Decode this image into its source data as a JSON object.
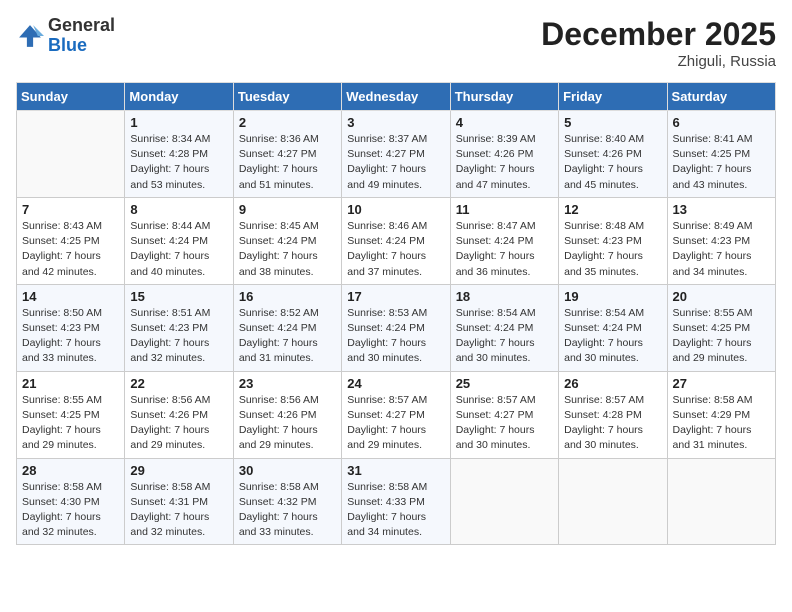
{
  "header": {
    "logo_general": "General",
    "logo_blue": "Blue",
    "title": "December 2025",
    "location": "Zhiguli, Russia"
  },
  "weekdays": [
    "Sunday",
    "Monday",
    "Tuesday",
    "Wednesday",
    "Thursday",
    "Friday",
    "Saturday"
  ],
  "weeks": [
    [
      {
        "day": "",
        "info": ""
      },
      {
        "day": "1",
        "info": "Sunrise: 8:34 AM\nSunset: 4:28 PM\nDaylight: 7 hours\nand 53 minutes."
      },
      {
        "day": "2",
        "info": "Sunrise: 8:36 AM\nSunset: 4:27 PM\nDaylight: 7 hours\nand 51 minutes."
      },
      {
        "day": "3",
        "info": "Sunrise: 8:37 AM\nSunset: 4:27 PM\nDaylight: 7 hours\nand 49 minutes."
      },
      {
        "day": "4",
        "info": "Sunrise: 8:39 AM\nSunset: 4:26 PM\nDaylight: 7 hours\nand 47 minutes."
      },
      {
        "day": "5",
        "info": "Sunrise: 8:40 AM\nSunset: 4:26 PM\nDaylight: 7 hours\nand 45 minutes."
      },
      {
        "day": "6",
        "info": "Sunrise: 8:41 AM\nSunset: 4:25 PM\nDaylight: 7 hours\nand 43 minutes."
      }
    ],
    [
      {
        "day": "7",
        "info": "Sunrise: 8:43 AM\nSunset: 4:25 PM\nDaylight: 7 hours\nand 42 minutes."
      },
      {
        "day": "8",
        "info": "Sunrise: 8:44 AM\nSunset: 4:24 PM\nDaylight: 7 hours\nand 40 minutes."
      },
      {
        "day": "9",
        "info": "Sunrise: 8:45 AM\nSunset: 4:24 PM\nDaylight: 7 hours\nand 38 minutes."
      },
      {
        "day": "10",
        "info": "Sunrise: 8:46 AM\nSunset: 4:24 PM\nDaylight: 7 hours\nand 37 minutes."
      },
      {
        "day": "11",
        "info": "Sunrise: 8:47 AM\nSunset: 4:24 PM\nDaylight: 7 hours\nand 36 minutes."
      },
      {
        "day": "12",
        "info": "Sunrise: 8:48 AM\nSunset: 4:23 PM\nDaylight: 7 hours\nand 35 minutes."
      },
      {
        "day": "13",
        "info": "Sunrise: 8:49 AM\nSunset: 4:23 PM\nDaylight: 7 hours\nand 34 minutes."
      }
    ],
    [
      {
        "day": "14",
        "info": "Sunrise: 8:50 AM\nSunset: 4:23 PM\nDaylight: 7 hours\nand 33 minutes."
      },
      {
        "day": "15",
        "info": "Sunrise: 8:51 AM\nSunset: 4:23 PM\nDaylight: 7 hours\nand 32 minutes."
      },
      {
        "day": "16",
        "info": "Sunrise: 8:52 AM\nSunset: 4:24 PM\nDaylight: 7 hours\nand 31 minutes."
      },
      {
        "day": "17",
        "info": "Sunrise: 8:53 AM\nSunset: 4:24 PM\nDaylight: 7 hours\nand 30 minutes."
      },
      {
        "day": "18",
        "info": "Sunrise: 8:54 AM\nSunset: 4:24 PM\nDaylight: 7 hours\nand 30 minutes."
      },
      {
        "day": "19",
        "info": "Sunrise: 8:54 AM\nSunset: 4:24 PM\nDaylight: 7 hours\nand 30 minutes."
      },
      {
        "day": "20",
        "info": "Sunrise: 8:55 AM\nSunset: 4:25 PM\nDaylight: 7 hours\nand 29 minutes."
      }
    ],
    [
      {
        "day": "21",
        "info": "Sunrise: 8:55 AM\nSunset: 4:25 PM\nDaylight: 7 hours\nand 29 minutes."
      },
      {
        "day": "22",
        "info": "Sunrise: 8:56 AM\nSunset: 4:26 PM\nDaylight: 7 hours\nand 29 minutes."
      },
      {
        "day": "23",
        "info": "Sunrise: 8:56 AM\nSunset: 4:26 PM\nDaylight: 7 hours\nand 29 minutes."
      },
      {
        "day": "24",
        "info": "Sunrise: 8:57 AM\nSunset: 4:27 PM\nDaylight: 7 hours\nand 29 minutes."
      },
      {
        "day": "25",
        "info": "Sunrise: 8:57 AM\nSunset: 4:27 PM\nDaylight: 7 hours\nand 30 minutes."
      },
      {
        "day": "26",
        "info": "Sunrise: 8:57 AM\nSunset: 4:28 PM\nDaylight: 7 hours\nand 30 minutes."
      },
      {
        "day": "27",
        "info": "Sunrise: 8:58 AM\nSunset: 4:29 PM\nDaylight: 7 hours\nand 31 minutes."
      }
    ],
    [
      {
        "day": "28",
        "info": "Sunrise: 8:58 AM\nSunset: 4:30 PM\nDaylight: 7 hours\nand 32 minutes."
      },
      {
        "day": "29",
        "info": "Sunrise: 8:58 AM\nSunset: 4:31 PM\nDaylight: 7 hours\nand 32 minutes."
      },
      {
        "day": "30",
        "info": "Sunrise: 8:58 AM\nSunset: 4:32 PM\nDaylight: 7 hours\nand 33 minutes."
      },
      {
        "day": "31",
        "info": "Sunrise: 8:58 AM\nSunset: 4:33 PM\nDaylight: 7 hours\nand 34 minutes."
      },
      {
        "day": "",
        "info": ""
      },
      {
        "day": "",
        "info": ""
      },
      {
        "day": "",
        "info": ""
      }
    ]
  ]
}
